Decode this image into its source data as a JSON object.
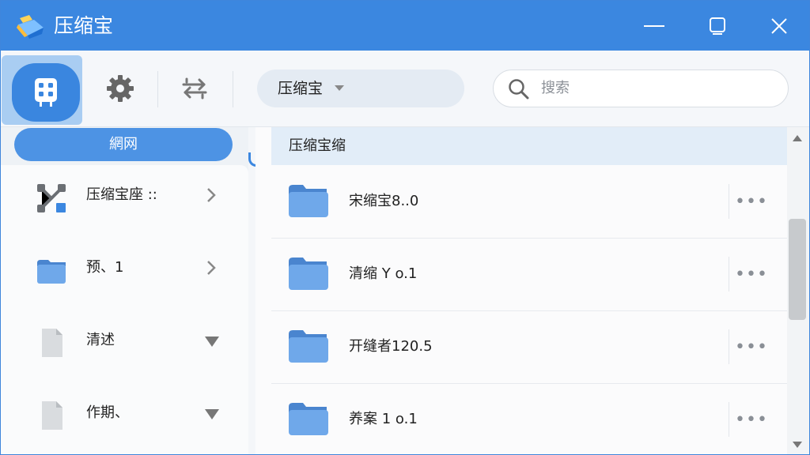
{
  "app": {
    "title": "压缩宝"
  },
  "toolbar": {
    "path_label": "压缩宝",
    "search": {
      "placeholder": "搜索"
    }
  },
  "left_panel": {
    "tab_label": "網网",
    "items": [
      {
        "label": "压缩宝座 ::",
        "icon": "network-icon",
        "indicator": "chevron-right"
      },
      {
        "label": "预、1",
        "icon": "folder-icon",
        "indicator": "chevron-right"
      },
      {
        "label": "清述",
        "icon": "file-icon",
        "indicator": "triangle-down"
      },
      {
        "label": "作期、",
        "icon": "file-icon",
        "indicator": "triangle-down"
      }
    ]
  },
  "file_list": {
    "header": "压缩宝缩",
    "items": [
      {
        "name": "宋缩宝8..0",
        "more": "•••"
      },
      {
        "name": "清缩 Y o.1",
        "more": "•••"
      },
      {
        "name": "开缝者120.5",
        "more": "•••"
      },
      {
        "name": "养案 1 o.1",
        "more": "•••"
      }
    ]
  },
  "colors": {
    "accent": "#3b87e0",
    "folder": "#6fa8ea",
    "folder_tab": "#4a85cf"
  }
}
